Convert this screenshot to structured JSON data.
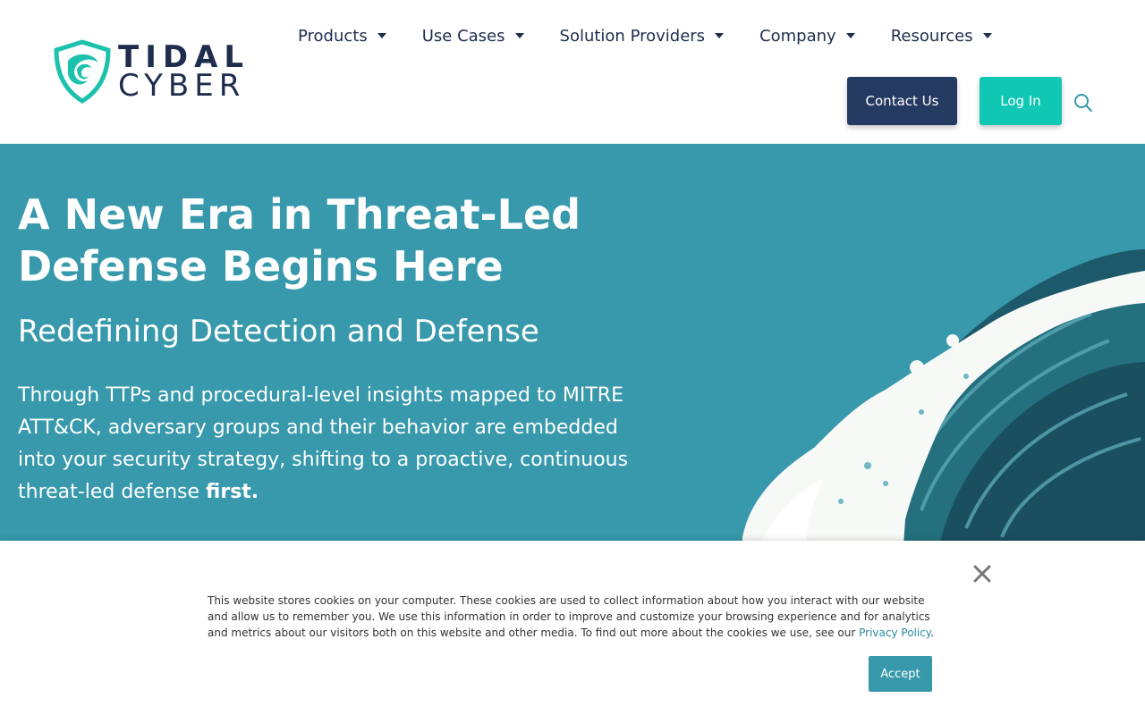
{
  "brand": {
    "line1": "TIDAL",
    "line2": "CYBER",
    "accent": "#1dc2ae",
    "navy": "#1f2d4d"
  },
  "nav": {
    "items": [
      {
        "label": "Products"
      },
      {
        "label": "Use Cases"
      },
      {
        "label": "Solution Providers"
      },
      {
        "label": "Company"
      },
      {
        "label": "Resources"
      }
    ],
    "contact_label": "Contact Us",
    "login_label": "Log In",
    "search_icon": "search-icon"
  },
  "hero": {
    "title": "A New Era in Threat-Led Defense Begins Here",
    "subtitle": "Redefining Detection and Defense",
    "body_text": "Through TTPs and procedural-level insights mapped to MITRE ATT&CK, adversary groups and their behavior are embedded into your security strategy, shifting to a proactive, continuous threat-led defense ",
    "body_emphasis": "first.",
    "background": "#3799ab"
  },
  "cookie_banner": {
    "text": "This website stores cookies on your computer. These cookies are used to collect information about how you interact with our website and allow us to remember you. We use this information in order to improve and customize your browsing experience and for analytics and metrics about our visitors both on this website and other media. To find out more about the cookies we use, see our ",
    "link_label": "Privacy Policy",
    "suffix": ".",
    "accept_label": "Accept",
    "close_icon": "close-icon"
  }
}
